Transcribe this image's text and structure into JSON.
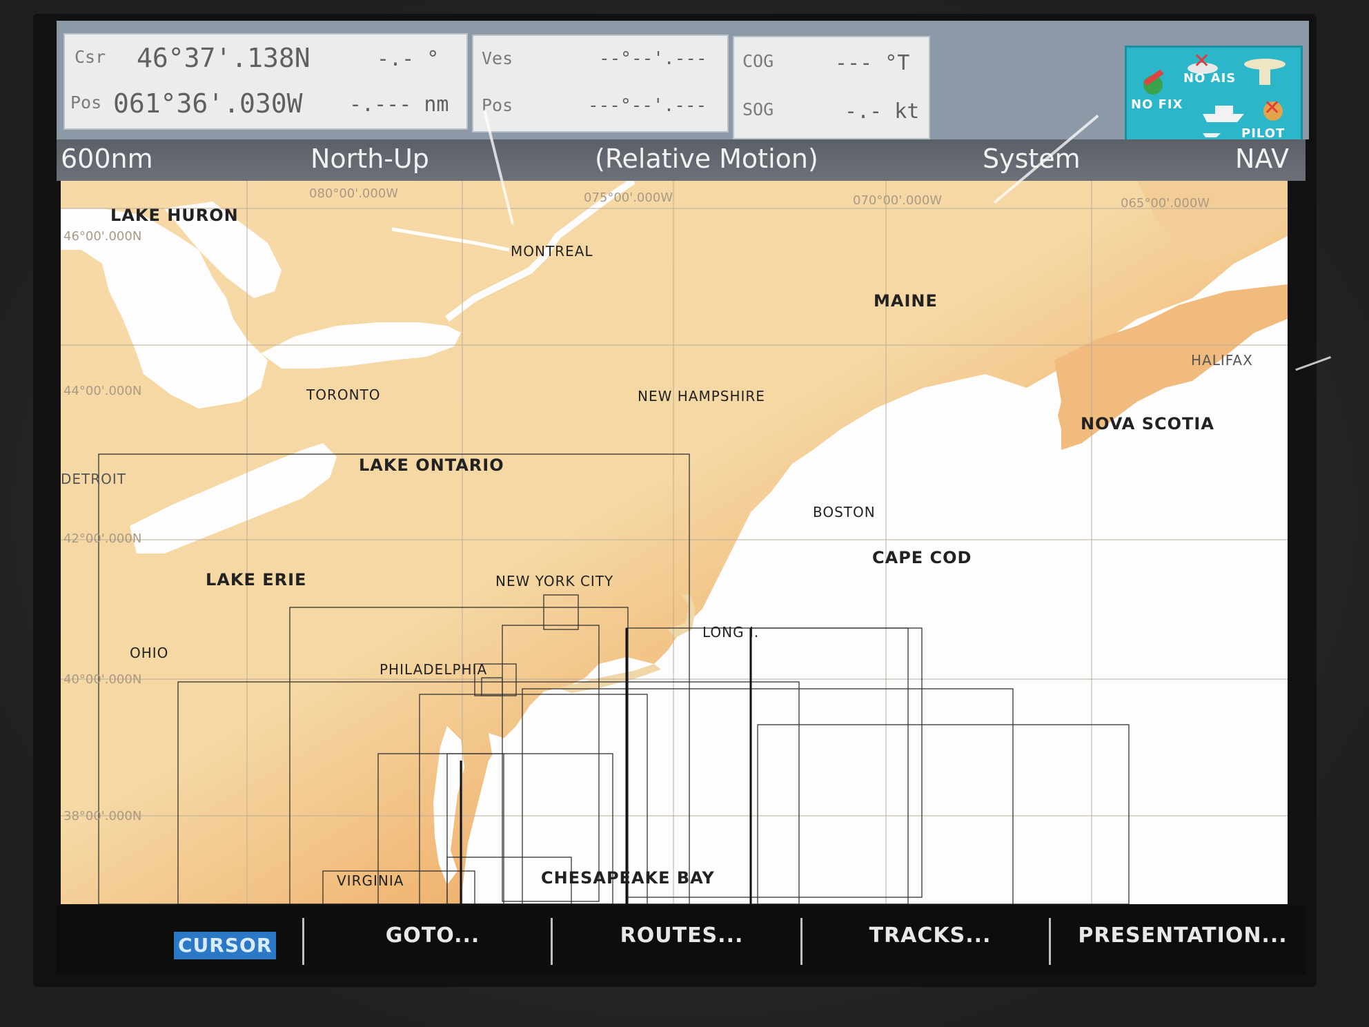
{
  "data_panel": {
    "cursor": {
      "csr_label": "Csr",
      "lat": "46°37'.138N",
      "bearing": "-.- °",
      "pos_label": "Pos",
      "lon": "061°36'.030W",
      "range": "-.--- nm"
    },
    "vessel": {
      "ves_label": "Ves",
      "ves_value": "--°--'.---",
      "pos_label": "Pos",
      "pos_value": "---°--'.---"
    },
    "nav": {
      "cog_label": "COG",
      "cog_value": "--- °T",
      "sog_label": "SOG",
      "sog_value": "-.- kt"
    },
    "status": {
      "no_fix": "NO FIX",
      "no_ais": "NO AIS",
      "pilot": "PILOT"
    }
  },
  "title_bar": {
    "range": "600nm",
    "orientation": "North-Up",
    "motion": "(Relative Motion)",
    "datum": "System",
    "mode": "NAV"
  },
  "chart": {
    "grid_labels": {
      "lon_080": "080°00'.000W",
      "lon_075": "075°00'.000W",
      "lon_070": "070°00'.000W",
      "lon_065": "065°00'.000W",
      "lat_46": "46°00'.000N",
      "lat_44": "44°00'.000N",
      "lat_42": "42°00'.000N",
      "lat_40": "40°00'.000N",
      "lat_38": "38°00'.000N"
    },
    "places": {
      "lake_huron": "LAKE HURON",
      "montreal": "MONTREAL",
      "maine": "MAINE",
      "halifax": "HALIFAX",
      "toronto": "TORONTO",
      "new_hampshire": "NEW HAMPSHIRE",
      "nova_scotia": "NOVA SCOTIA",
      "detroit": "DETROIT",
      "lake_ontario": "LAKE ONTARIO",
      "boston": "BOSTON",
      "cape_cod": "CAPE COD",
      "lake_erie": "LAKE ERIE",
      "new_york_city": "NEW YORK CITY",
      "long_island": "LONG I.",
      "ohio": "OHIO",
      "philadelphia": "PHILADELPHIA",
      "virginia": "VIRGINIA",
      "chesapeake_bay": "CHESAPEAKE BAY"
    },
    "colors": {
      "land_light": "#f7e2b4",
      "land_dark": "#e98a2a",
      "water": "#fdfdfd",
      "grid": "#b9ad9c"
    }
  },
  "softkeys": {
    "cursor": "CURSOR",
    "goto": "GOTO...",
    "routes": "ROUTES...",
    "tracks": "TRACKS...",
    "presentation": "PRESENTATION..."
  }
}
